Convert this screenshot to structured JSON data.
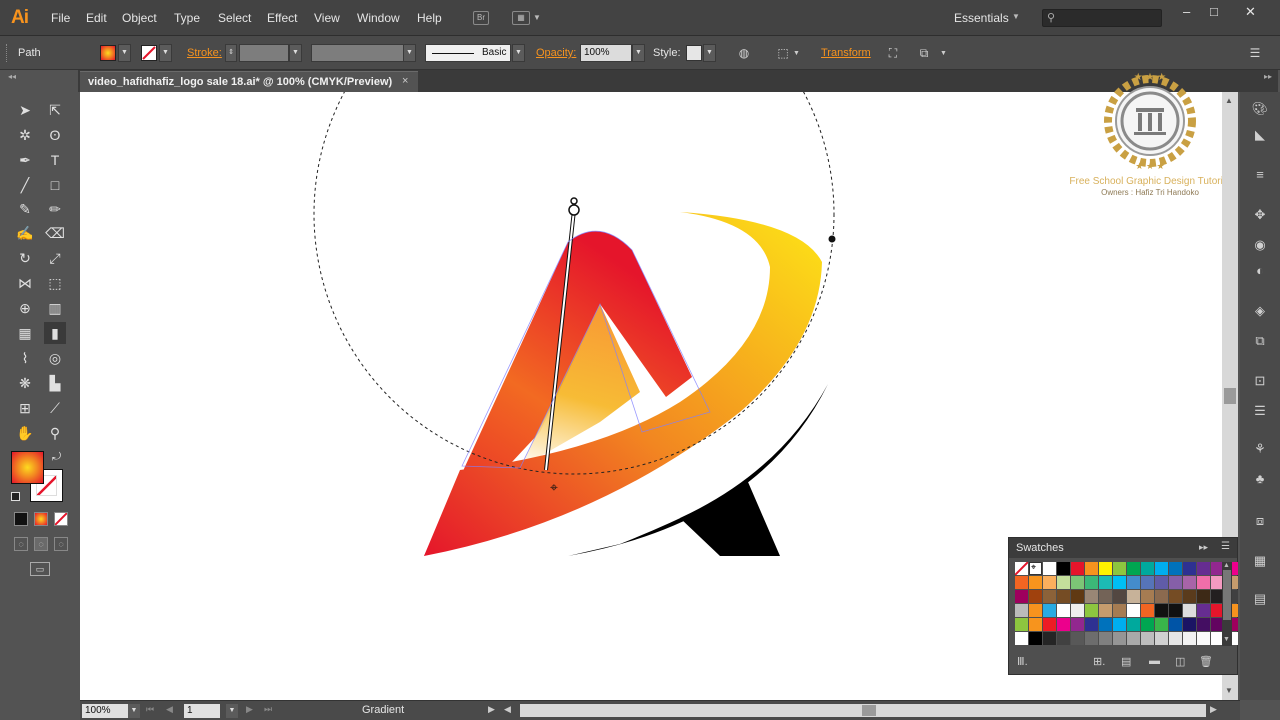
{
  "app": {
    "logo": "Ai",
    "bridge_label": "Br"
  },
  "menu": [
    "File",
    "Edit",
    "Object",
    "Type",
    "Select",
    "Effect",
    "View",
    "Window",
    "Help"
  ],
  "workspace": {
    "label": "Essentials"
  },
  "control": {
    "selection_type": "Path",
    "stroke_label": "Stroke:",
    "brush_label": "Basic",
    "opacity_label": "Opacity:",
    "opacity_value": "100%",
    "style_label": "Style:",
    "transform_label": "Transform"
  },
  "document": {
    "tab_title": "video_hafidhafiz_logo sale 18.ai* @ 100% (CMYK/Preview)",
    "close_glyph": "×"
  },
  "watermark": {
    "line1": "Free School Graphic Design Tutorial",
    "line2": "Owners : Hafiz Tri Handoko"
  },
  "swatches_panel": {
    "title": "Swatches"
  },
  "status": {
    "zoom": "100%",
    "page": "1",
    "tool_status": "Gradient"
  },
  "colors": {
    "accent": "#f7931e",
    "gradient_red": "#e5152b",
    "gradient_orange": "#f28621",
    "gradient_yellow": "#fddb1f",
    "swoosh_black": "#000000"
  },
  "icons": {
    "selection": "selection-arrow-icon",
    "direct_selection": "direct-selection-icon",
    "magic_wand": "magic-wand-icon",
    "lasso": "lasso-icon",
    "pen": "pen-icon",
    "type": "type-icon",
    "line": "line-segment-icon",
    "rectangle": "rectangle-icon",
    "paintbrush": "paintbrush-icon",
    "pencil": "pencil-icon",
    "blob_brush": "blob-brush-icon",
    "eraser": "eraser-icon",
    "rotate": "rotate-icon",
    "scale": "scale-icon",
    "width": "width-icon",
    "free_transform": "free-transform-icon",
    "shape_builder": "shape-builder-icon",
    "perspective": "perspective-grid-icon",
    "mesh": "mesh-icon",
    "gradient": "gradient-tool-icon",
    "eyedropper": "eyedropper-icon",
    "blend": "blend-icon",
    "symbol_sprayer": "symbol-sprayer-icon",
    "graph": "column-graph-icon",
    "artboard": "artboard-icon",
    "slice": "slice-icon",
    "hand": "hand-icon",
    "zoom": "zoom-icon"
  }
}
